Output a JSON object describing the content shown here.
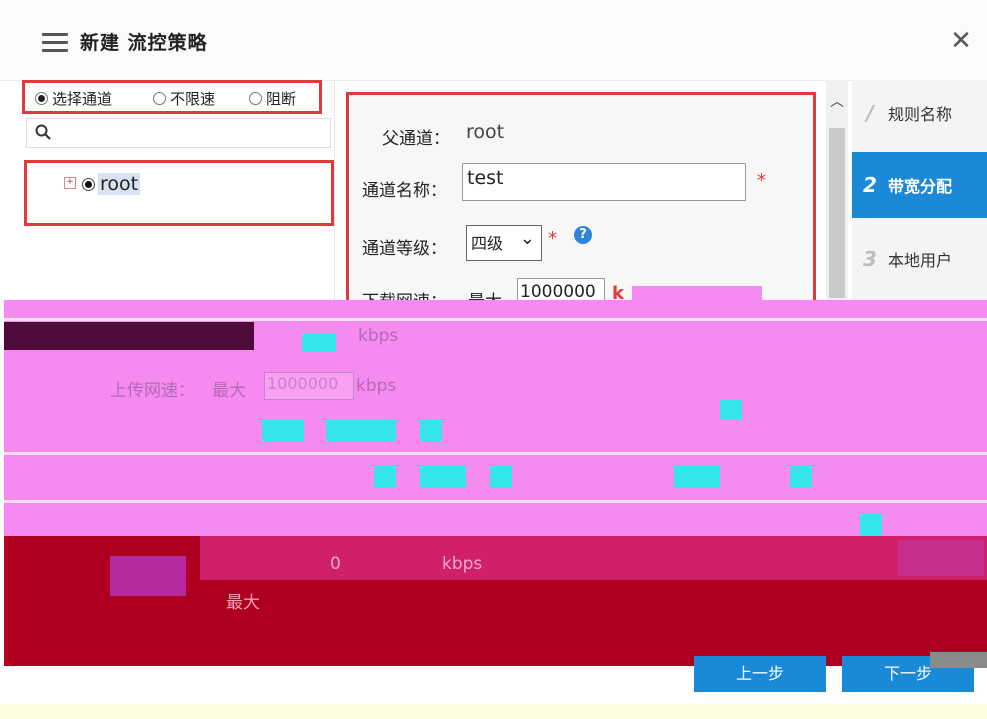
{
  "dialog": {
    "title": "新建 流控策略",
    "close_symbol": "✕"
  },
  "mode": {
    "options": [
      {
        "label": "选择通道",
        "selected": true
      },
      {
        "label": "不限速",
        "selected": false
      },
      {
        "label": "阻断",
        "selected": false
      }
    ]
  },
  "search": {
    "placeholder": "",
    "icon": "search-icon"
  },
  "tree": {
    "expander": "+",
    "nodes": [
      {
        "label": "root",
        "selected": true
      }
    ]
  },
  "form": {
    "parent_label": "父通道：",
    "parent_value": "root",
    "name_label": "通道名称：",
    "name_value": "test",
    "level_label": "通道等级：",
    "level_value": "四级",
    "level_arrow": "⌄",
    "required_mark": "*",
    "help_symbol": "?",
    "download_label": "下载网速：",
    "download_max_label": "最大",
    "download_max_value": "1000000",
    "download_unit_partial": "k"
  },
  "ghost": {
    "kbps_1": "kbps",
    "upload_label": "上传网速：",
    "upload_max_label": "最大",
    "upload_max_value": "1000000",
    "upload_unit": "kbps",
    "bottom_value": "0",
    "bottom_unit": "kbps",
    "bottom_max_label": "最大"
  },
  "steps": [
    {
      "num": "/",
      "label": "规则名称",
      "active": false
    },
    {
      "num": "2",
      "label": "带宽分配",
      "active": true
    },
    {
      "num": "3",
      "label": "本地用户",
      "active": false
    }
  ],
  "footer": {
    "prev_label": "上一步",
    "next_label": "下一步"
  },
  "colors": {
    "accent": "#1a8ad8",
    "highlight_border": "#e03a3a",
    "required": "#e03a3a"
  }
}
